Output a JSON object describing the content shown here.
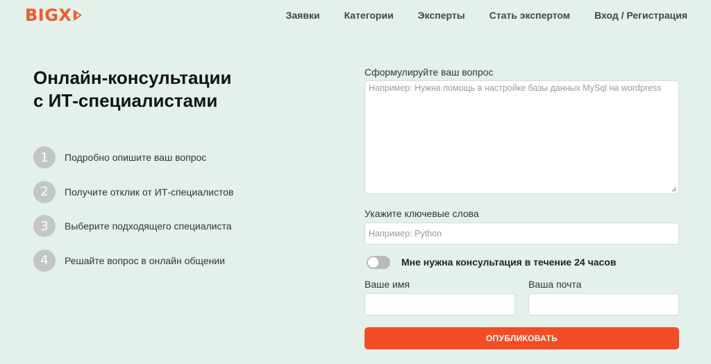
{
  "header": {
    "logo_text": "BIGX",
    "nav": [
      "Заявки",
      "Категории",
      "Эксперты",
      "Стать экспертом",
      "Вход / Регистрация"
    ]
  },
  "hero": {
    "title_line1": "Онлайн-консультации",
    "title_line2": "с ИТ-специалистами"
  },
  "steps": [
    {
      "num": "1",
      "text": "Подробно опишите ваш вопрос"
    },
    {
      "num": "2",
      "text": "Получите отклик от ИТ-специалистов"
    },
    {
      "num": "3",
      "text": "Выберите подходящего специалиста"
    },
    {
      "num": "4",
      "text": "Решайте вопрос в онлайн общении"
    }
  ],
  "form": {
    "question_label": "Сформулируйте ваш вопрос",
    "question_placeholder": "Например: Нужна помощь в настройке базы данных MySql на wordpress",
    "keywords_label": "Укажите ключевые слова",
    "keywords_placeholder": "Например: Python",
    "urgent_label": "Мне нужна консультация в течение 24 часов",
    "urgent_on": false,
    "name_label": "Ваше имя",
    "email_label": "Ваша почта",
    "name_value": "",
    "email_value": "",
    "submit_label": "ОПУБЛИКОВАТЬ"
  },
  "colors": {
    "background": "#e3f1ea",
    "accent": "#f44c26",
    "logo": "#f05a2a"
  }
}
